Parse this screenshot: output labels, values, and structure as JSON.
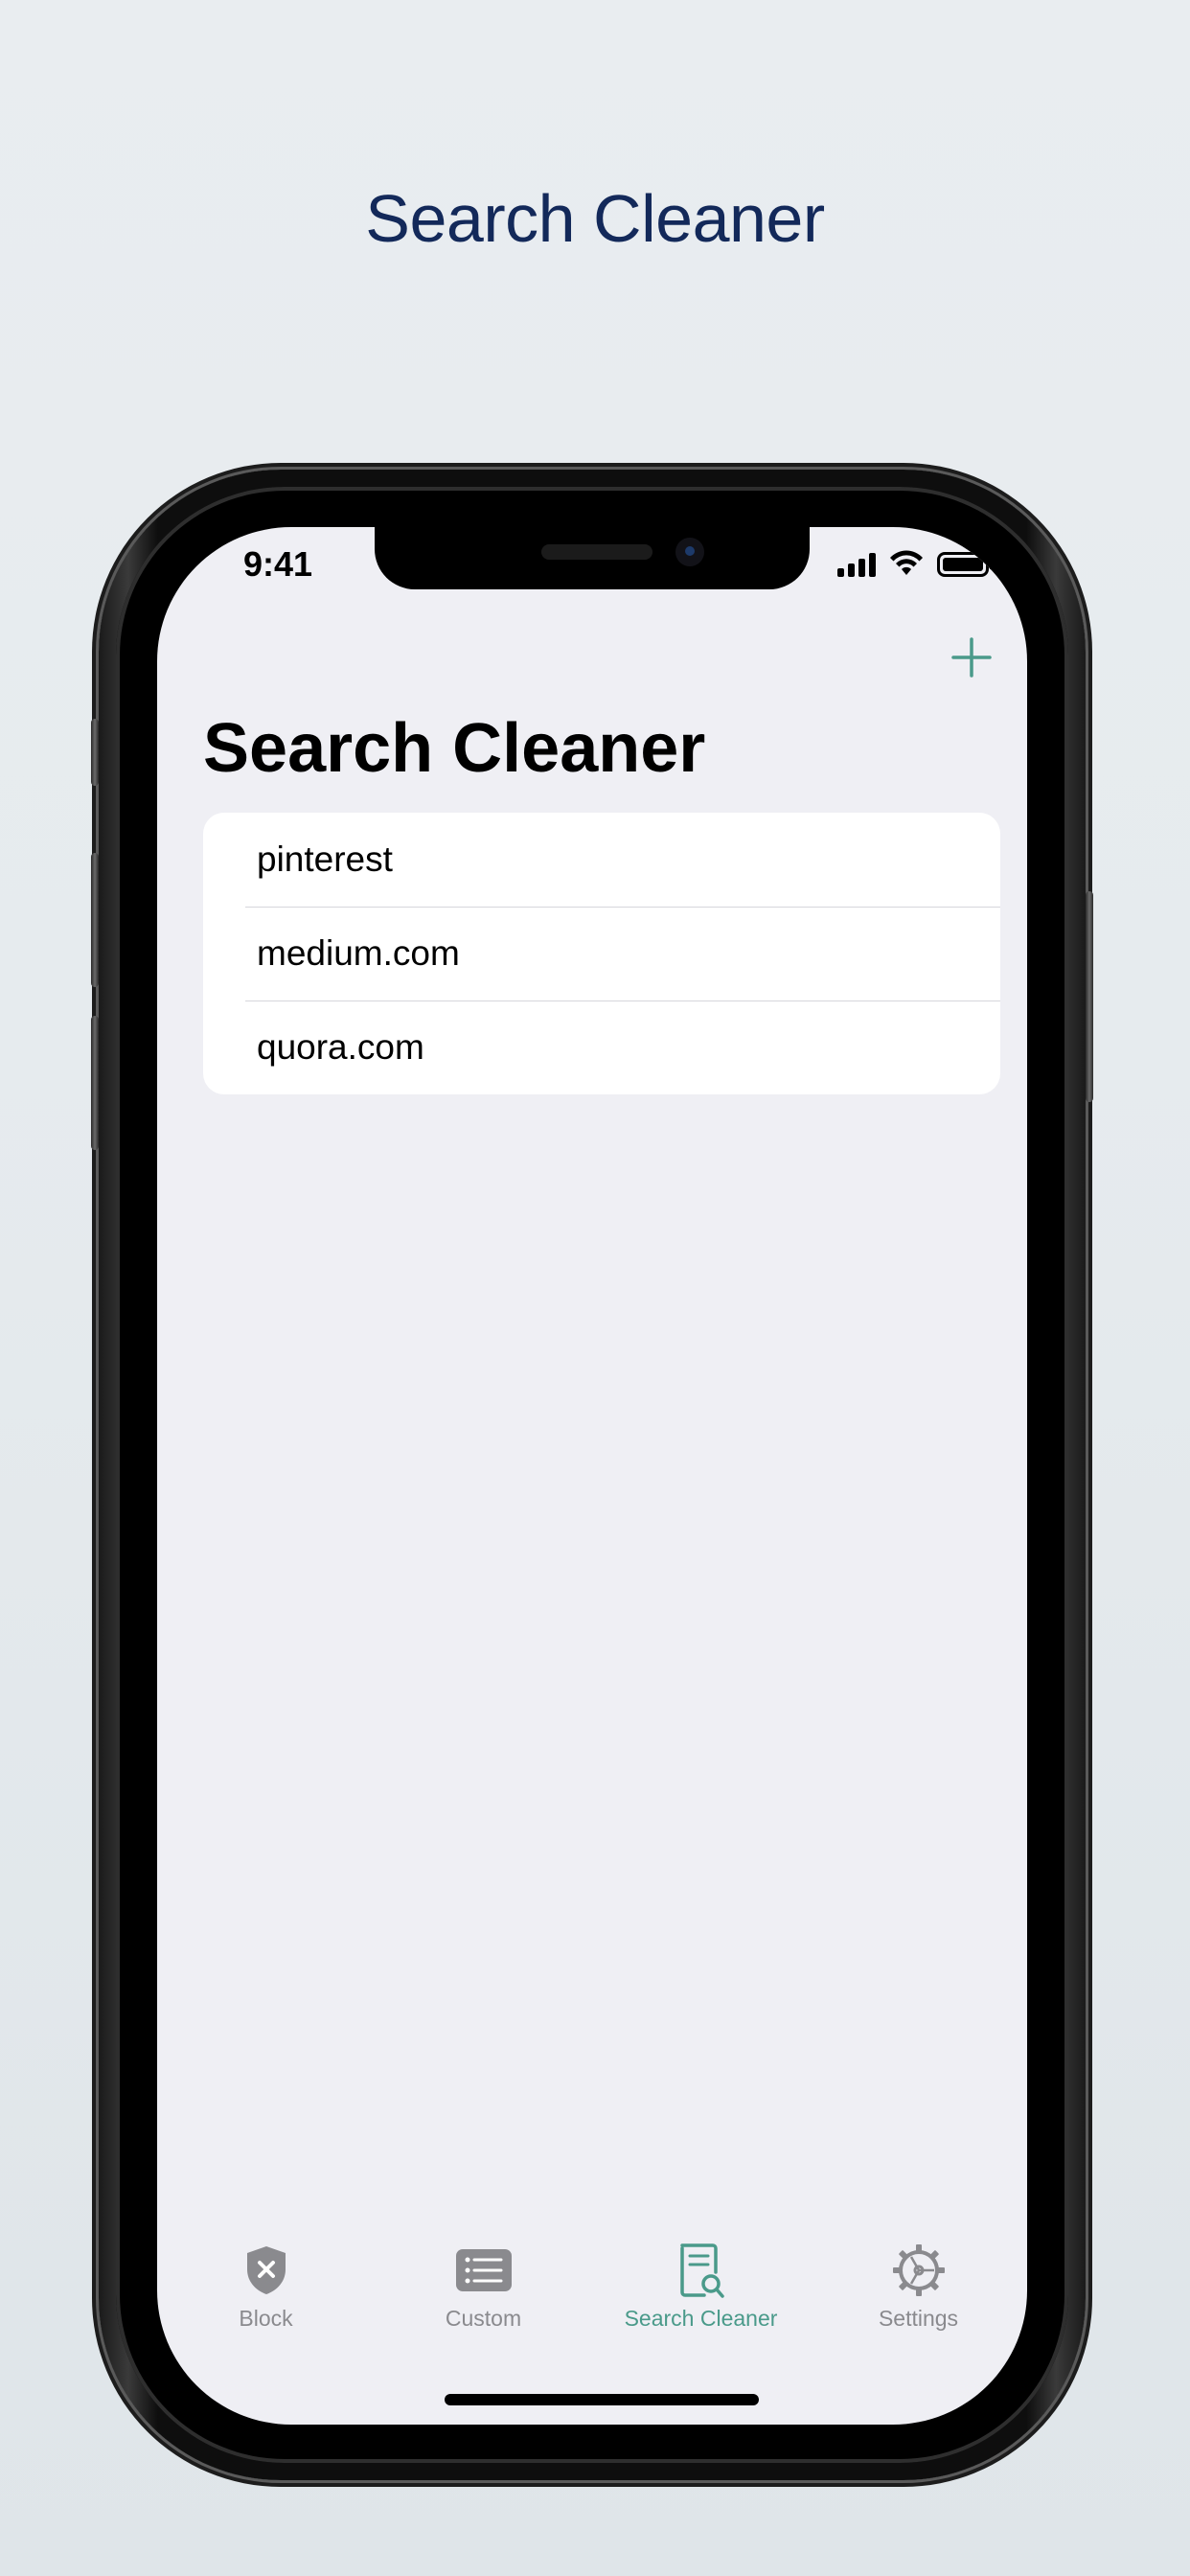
{
  "promo": {
    "title": "Search Cleaner"
  },
  "status_bar": {
    "time": "9:41"
  },
  "nav": {
    "add_icon": "plus-icon",
    "title": "Search Cleaner"
  },
  "list": {
    "items": [
      {
        "label": "pinterest"
      },
      {
        "label": "medium.com"
      },
      {
        "label": "quora.com"
      }
    ]
  },
  "tabbar": {
    "tabs": [
      {
        "label": "Block",
        "icon": "shield-x-icon",
        "active": false
      },
      {
        "label": "Custom",
        "icon": "list-icon",
        "active": false
      },
      {
        "label": "Search Cleaner",
        "icon": "document-search-icon",
        "active": true
      },
      {
        "label": "Settings",
        "icon": "gear-icon",
        "active": false
      }
    ]
  },
  "colors": {
    "accent": "#4a9a8a",
    "promo_title": "#13295a",
    "inactive": "#8a8a8e",
    "screen_bg": "#efeff4"
  }
}
